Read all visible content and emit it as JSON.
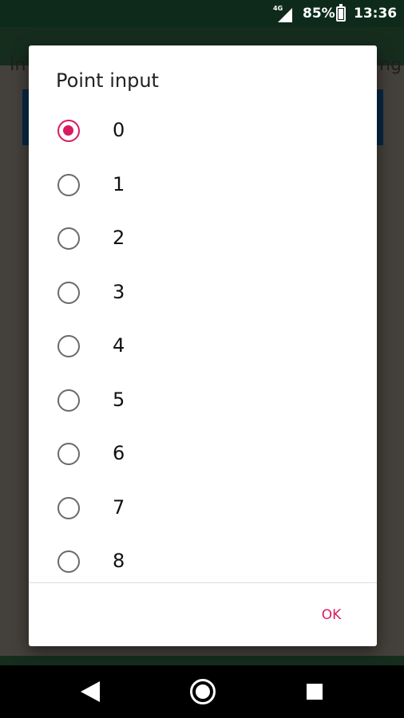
{
  "status_bar": {
    "network": "4G",
    "battery_percent": "85%",
    "battery_level": 0.85,
    "time": "13:36"
  },
  "background_app": {
    "left_text": "In",
    "right_text": "ng"
  },
  "dialog": {
    "title": "Point input",
    "selected": "0",
    "options": [
      "0",
      "1",
      "2",
      "3",
      "4",
      "5",
      "6",
      "7",
      "8"
    ],
    "ok_label": "OK"
  },
  "colors": {
    "accent": "#d81b60",
    "app_background": "#285238",
    "status_bar": "#0d2a1a"
  },
  "nav_bar": {
    "icons": [
      "back-icon",
      "home-icon",
      "recents-icon"
    ]
  }
}
